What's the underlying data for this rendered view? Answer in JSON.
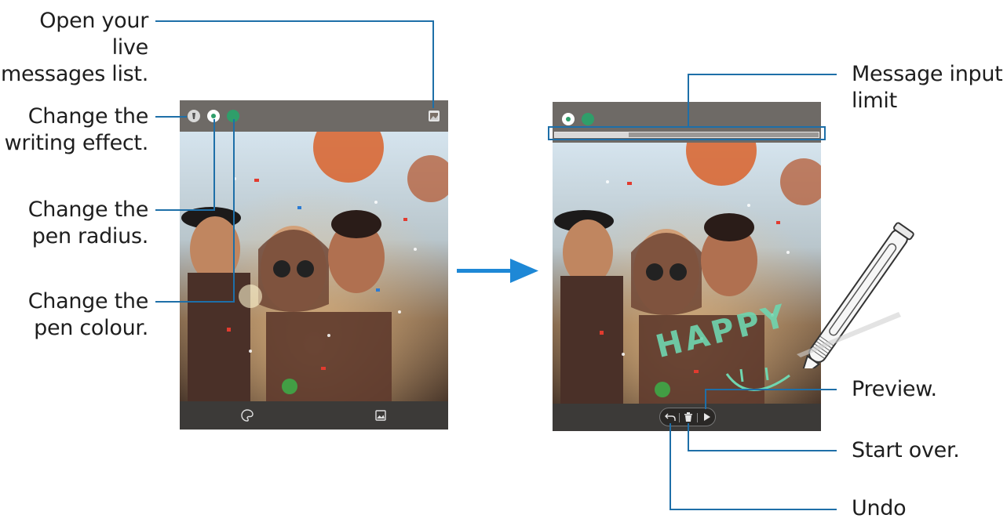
{
  "left_callouts": {
    "live_messages": "Open your live\nmessages list.",
    "writing_effect": "Change the\nwriting effect.",
    "pen_radius": "Change the\npen radius.",
    "pen_colour": "Change the\npen colour."
  },
  "right_callouts": {
    "input_limit": "Message input\nlimit",
    "preview": "Preview.",
    "start_over": "Start over.",
    "undo": "Undo"
  },
  "handwriting": {
    "text": "HAPPY"
  },
  "colors": {
    "callout_line": "#1e6fa8",
    "pen_color": "#2f9e6a",
    "arrow": "#1e88d6",
    "handwriting": "#6fd6b0"
  },
  "icons": {
    "writing_effect": "pen-effect-icon",
    "pen_radius": "pen-radius-icon",
    "pen_colour": "color-dot-icon",
    "live_messages": "gallery-list-icon",
    "background": "palette-icon",
    "gallery": "image-icon",
    "undo": "undo-icon",
    "delete": "trash-icon",
    "preview": "play-icon"
  }
}
